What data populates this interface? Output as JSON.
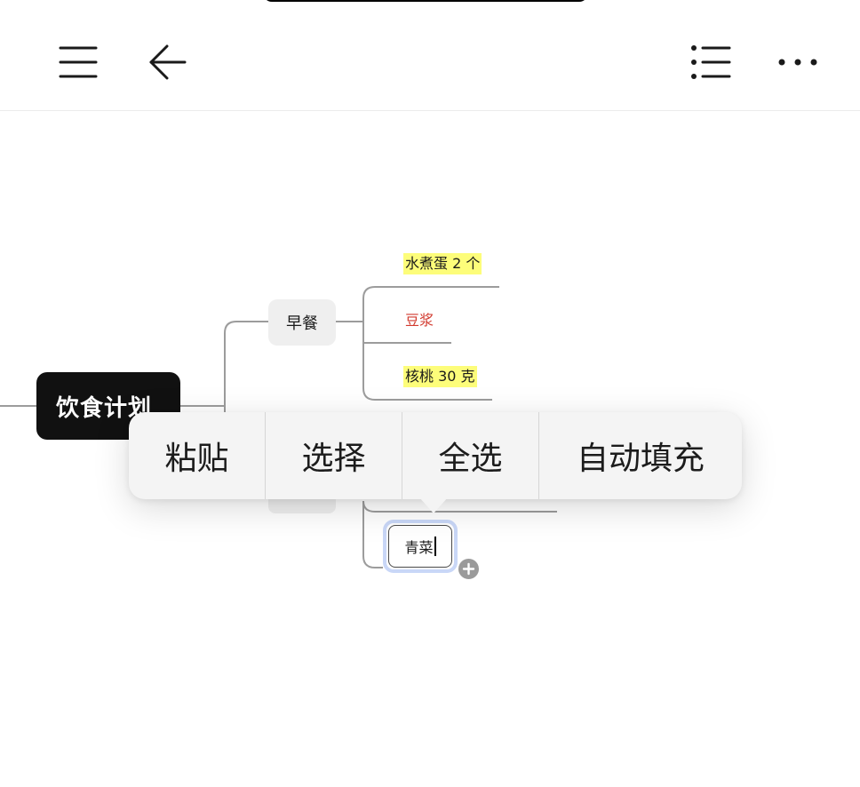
{
  "toolbar": {
    "menu_icon": "hamburger-icon",
    "back_icon": "arrow-left-icon",
    "outline_icon": "list-icon",
    "more_icon": "ellipsis-icon"
  },
  "mindmap": {
    "root": "饮食计划",
    "branch": "早餐",
    "leaves": [
      {
        "text": "水煮蛋 2 个",
        "style": "highlight"
      },
      {
        "text": "豆浆",
        "style": "red"
      },
      {
        "text": "核桃 30 克",
        "style": "highlight"
      }
    ],
    "editing_node": "青菜",
    "add_icon": "plus-circle-icon"
  },
  "context_menu": {
    "items": [
      "粘贴",
      "选择",
      "全选",
      "自动填充"
    ]
  },
  "colors": {
    "highlight": "#fdfd7a",
    "red_text": "#d23a2e",
    "root_bg": "#111111",
    "selection_ring": "#c9d7f7"
  }
}
